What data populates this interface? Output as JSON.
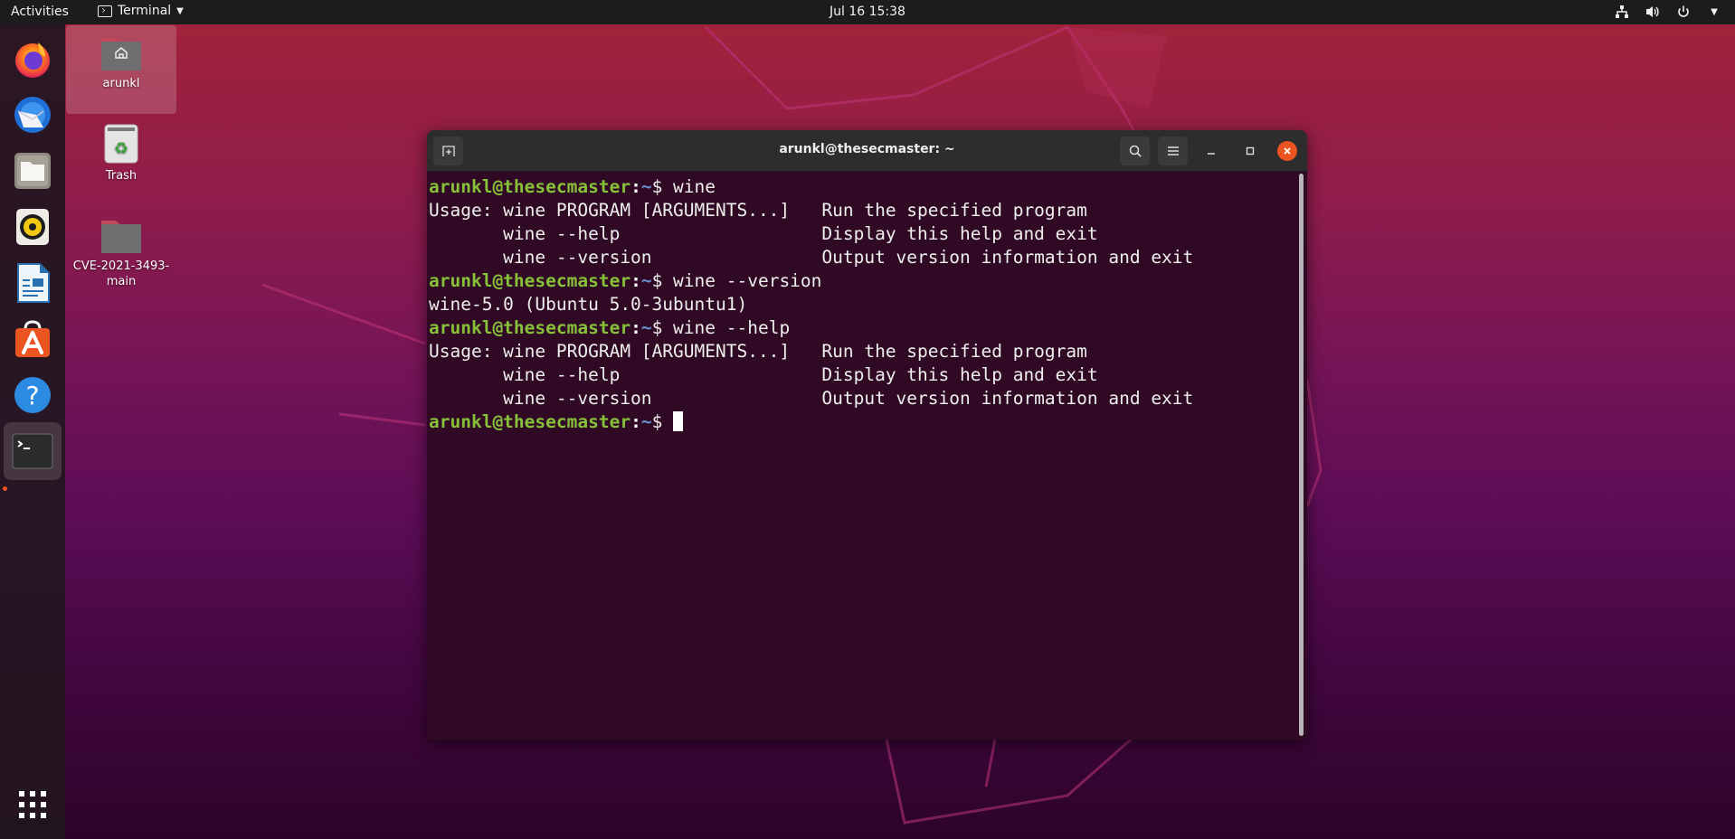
{
  "topbar": {
    "activities": "Activities",
    "app_name": "Terminal",
    "app_icon": "terminal-icon",
    "clock": "Jul 16  15:38",
    "tray_icons": [
      "network-icon",
      "volume-icon",
      "power-icon",
      "chevron-down-icon"
    ]
  },
  "dock": {
    "items": [
      {
        "name": "Firefox",
        "icon": "firefox-icon"
      },
      {
        "name": "Thunderbird Mail",
        "icon": "thunderbird-icon"
      },
      {
        "name": "Files",
        "icon": "files-icon"
      },
      {
        "name": "Rhythmbox",
        "icon": "rhythmbox-icon"
      },
      {
        "name": "LibreOffice Writer",
        "icon": "writer-icon"
      },
      {
        "name": "Ubuntu Software",
        "icon": "software-icon"
      },
      {
        "name": "Help",
        "icon": "help-icon"
      },
      {
        "name": "Terminal",
        "icon": "terminal-icon",
        "running": true
      }
    ],
    "show_apps_icon": "app-grid-icon"
  },
  "desktop": {
    "icons": [
      {
        "label": "arunkl",
        "icon": "home-folder-icon",
        "selected": true
      },
      {
        "label": "Trash",
        "icon": "trash-icon"
      },
      {
        "label": "CVE-2021-3493-\nmain",
        "icon": "folder-icon"
      }
    ]
  },
  "terminal": {
    "title": "arunkl@thesecmaster: ~",
    "buttons": {
      "new_tab": "new-tab-icon",
      "search": "search-icon",
      "menu": "hamburger-menu-icon",
      "minimize": "minimize-icon",
      "maximize": "maximize-icon",
      "close": "close-icon"
    },
    "prompt": {
      "user_host": "arunkl@thesecmaster",
      "colon": ":",
      "dir": "~",
      "symbol": "$ "
    },
    "lines": [
      {
        "type": "prompt",
        "cmd": "wine"
      },
      {
        "type": "out",
        "text": "Usage: wine PROGRAM [ARGUMENTS...]   Run the specified program"
      },
      {
        "type": "out",
        "text": "       wine --help                   Display this help and exit"
      },
      {
        "type": "out",
        "text": "       wine --version                Output version information and exit"
      },
      {
        "type": "prompt",
        "cmd": "wine --version"
      },
      {
        "type": "out",
        "text": "wine-5.0 (Ubuntu 5.0-3ubuntu1)"
      },
      {
        "type": "prompt",
        "cmd": "wine --help"
      },
      {
        "type": "out",
        "text": "Usage: wine PROGRAM [ARGUMENTS...]   Run the specified program"
      },
      {
        "type": "out",
        "text": "       wine --help                   Display this help and exit"
      },
      {
        "type": "out",
        "text": "       wine --version                Output version information and exit"
      },
      {
        "type": "prompt",
        "cmd": "",
        "cursor": true
      }
    ],
    "colors": {
      "background": "#300a24",
      "titlebar": "#2d2d2d",
      "user_host": "#87c13a",
      "dir": "#6a8fd1",
      "text": "#eeeeec",
      "close_button": "#e95420"
    }
  }
}
